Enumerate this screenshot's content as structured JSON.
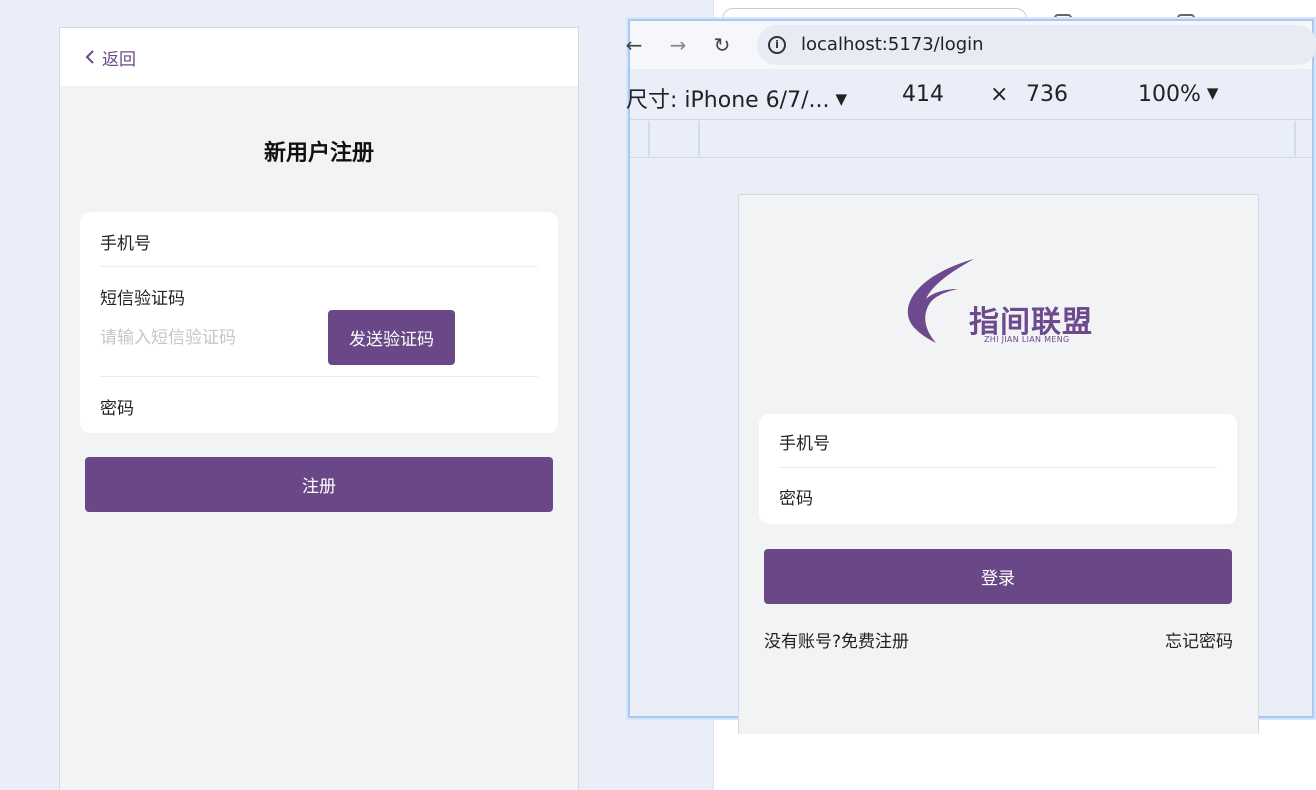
{
  "register": {
    "back_label": "返回",
    "title": "新用户注册",
    "phone_label": "手机号",
    "sms_label": "短信验证码",
    "sms_placeholder": "请输入短信验证码",
    "send_code_label": "发送验证码",
    "password_label": "密码",
    "submit_label": "注册"
  },
  "devtools": {
    "url": "localhost:5173/login",
    "device_label": "尺寸: iPhone 6/7/...",
    "width": "414",
    "times": "×",
    "height": "736",
    "zoom": "100%"
  },
  "login": {
    "logo_text": "指间联盟",
    "logo_sub": "ZHI JIAN LIAN MENG",
    "phone_label": "手机号",
    "password_label": "密码",
    "submit_label": "登录",
    "register_link": "没有账号?免费注册",
    "forgot_link": "忘记密码"
  },
  "colors": {
    "brand": "#6a4887",
    "page_bg": "#f2f3f5",
    "devtools_border": "#a9c8f3"
  }
}
